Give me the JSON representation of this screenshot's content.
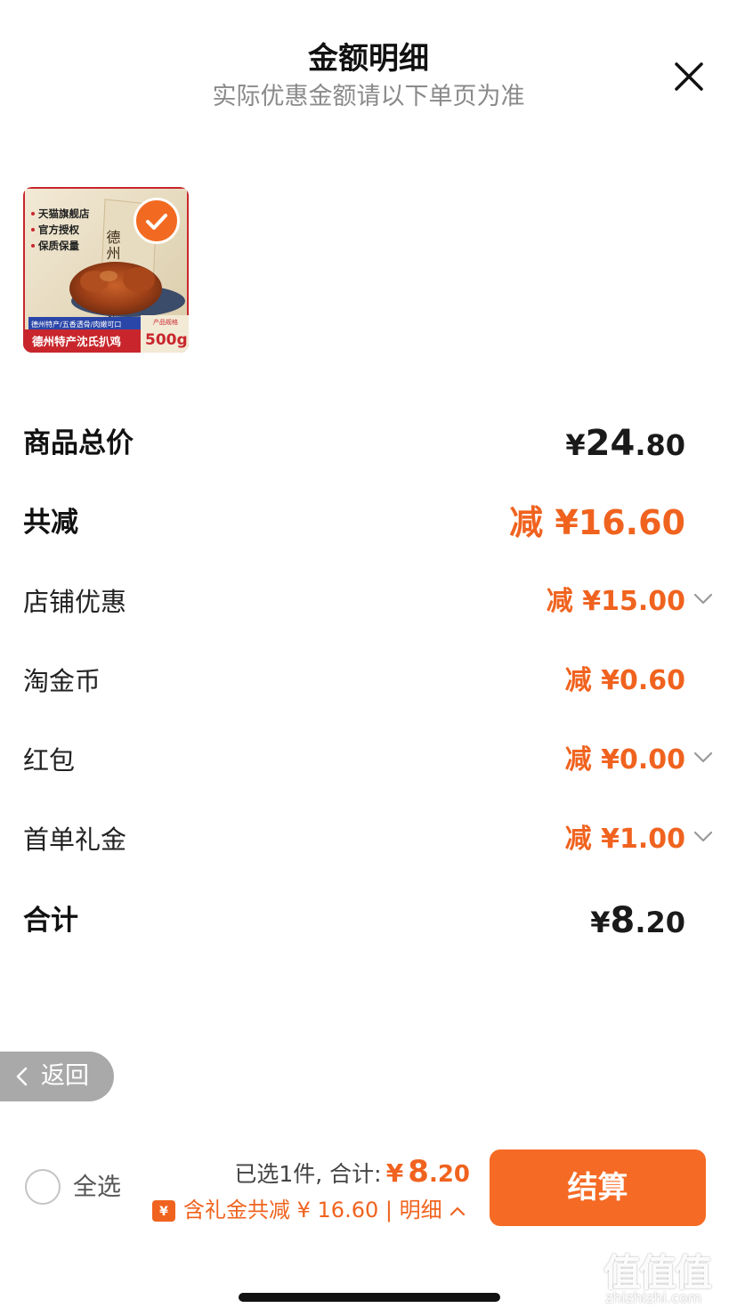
{
  "header": {
    "title": "金额明细",
    "subtitle": "实际优惠金额请以下单页为准"
  },
  "product": {
    "image_icon": "product-image",
    "image_lines": [
      "天猫旗舰店",
      "官方授权",
      "保质保量"
    ],
    "image_package_name": "德州沈氏扒鸡",
    "image_tags": "德州特产/五香透骨/肉嫩可口",
    "image_bottom_label": "德州特产沈氏扒鸡",
    "image_spec_label": "产品规格",
    "image_weight": "500g",
    "selected": true
  },
  "rows": {
    "total_price": {
      "label": "商品总价",
      "currency": "¥",
      "int": "24",
      "dec": ".80"
    },
    "total_discount": {
      "label": "共减",
      "prefix": "减",
      "amount": "¥16.60"
    },
    "shop_discount": {
      "label": "店铺优惠",
      "prefix": "减",
      "amount": "¥15.00"
    },
    "coins": {
      "label": "淘金币",
      "prefix": "减",
      "amount": "¥0.60"
    },
    "red_packet": {
      "label": "红包",
      "prefix": "减",
      "amount": "¥0.00"
    },
    "first_order_gift": {
      "label": "首单礼金",
      "prefix": "减",
      "amount": "¥1.00"
    },
    "subtotal": {
      "label": "合计",
      "currency": "¥",
      "int": "8",
      "dec": ".20"
    }
  },
  "back": {
    "label": "返回"
  },
  "footer": {
    "select_all_label": "全选",
    "selected_text": "已选1件, 合计:",
    "currency": "¥",
    "sum_int": "8",
    "sum_dec": ".20",
    "discount_text": "含礼金共减 ¥ 16.60 | 明细",
    "checkout_label": "结算"
  },
  "watermark": {
    "logo": "值值值",
    "url": "zhizhizhi.com"
  },
  "colors": {
    "accent": "#f0631f",
    "button": "#f56a24",
    "muted": "#8a8a8a"
  }
}
